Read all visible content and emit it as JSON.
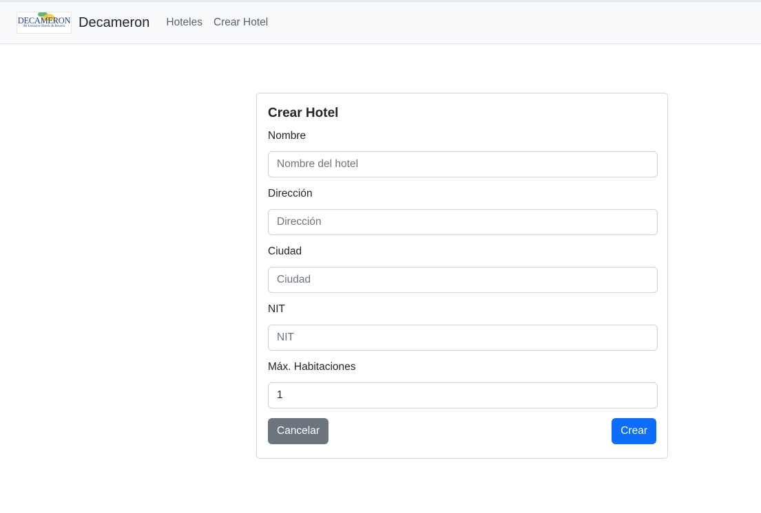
{
  "colors": {
    "navbar_bg": "#f8f9fa",
    "primary": "#0d6efd",
    "secondary": "#6c757d",
    "border": "#ced4da"
  },
  "navbar": {
    "logo": {
      "word": "DECAMERON",
      "tagline": "All Inclusive Hotels & Resorts"
    },
    "brand_name": "Decameron",
    "links": [
      {
        "label": "Hoteles"
      },
      {
        "label": "Crear Hotel"
      }
    ]
  },
  "form": {
    "title": "Crear Hotel",
    "fields": [
      {
        "label": "Nombre",
        "placeholder": "Nombre del hotel",
        "value": ""
      },
      {
        "label": "Dirección",
        "placeholder": "Dirección",
        "value": ""
      },
      {
        "label": "Ciudad",
        "placeholder": "Ciudad",
        "value": ""
      },
      {
        "label": "NIT",
        "placeholder": "NIT",
        "value": ""
      },
      {
        "label": "Máx. Habitaciones",
        "placeholder": "",
        "value": "1"
      }
    ],
    "cancel_label": "Cancelar",
    "submit_label": "Crear"
  }
}
